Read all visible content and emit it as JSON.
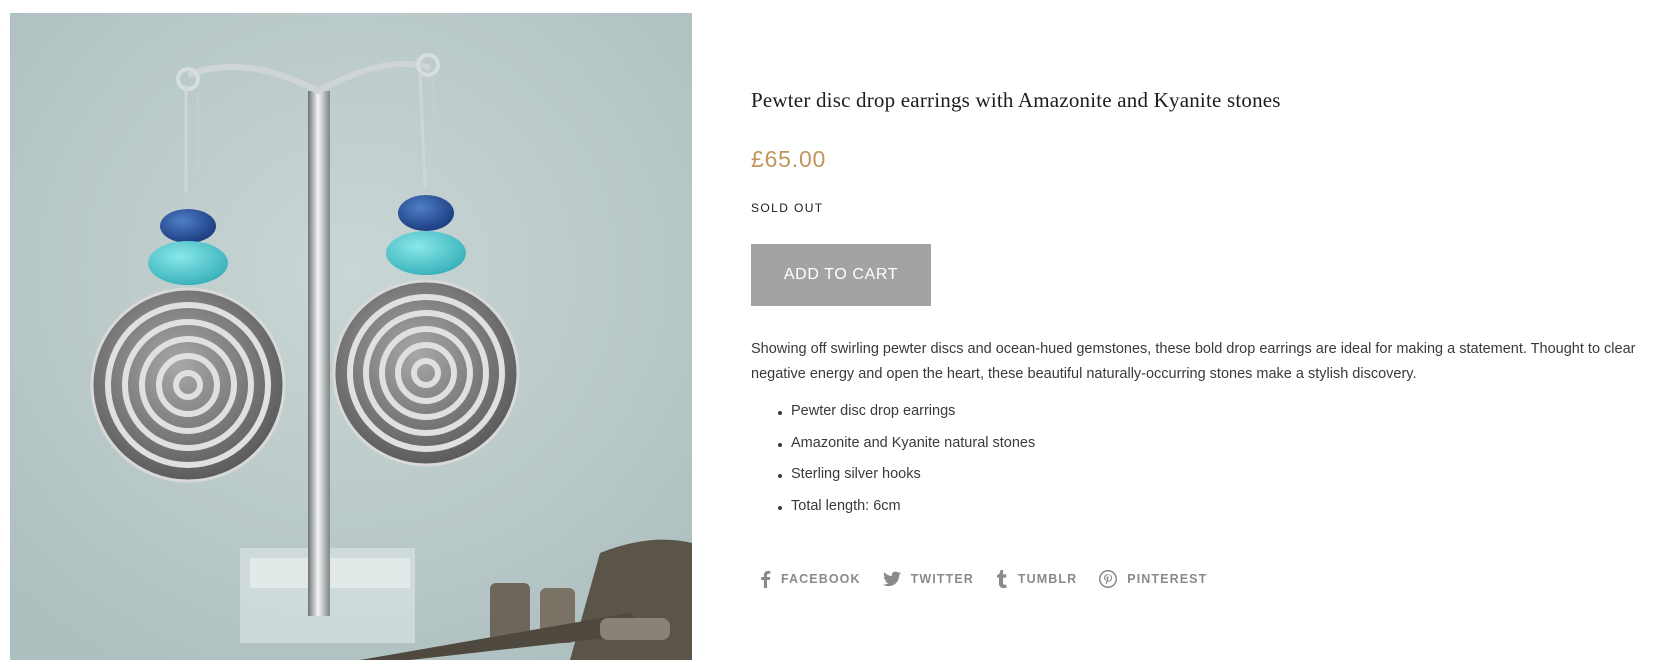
{
  "product": {
    "image_alt": "Pewter disc drop earrings with Amazonite and Kyanite stones on a display stand",
    "title": "Pewter disc drop earrings with Amazonite and Kyanite stones",
    "price": "£65.00",
    "availability": "SOLD OUT",
    "add_to_cart_label": "ADD TO CART",
    "description": "Showing off swirling pewter discs and ocean-hued gemstones, these bold drop earrings are ideal for making a statement. Thought to clear negative energy and open the heart, these beautiful naturally-occurring stones make a stylish discovery.",
    "features": [
      "Pewter disc drop earrings",
      "Amazonite and Kyanite natural stones",
      "Sterling silver hooks",
      "Total length: 6cm"
    ]
  },
  "share": {
    "facebook": {
      "label": "FACEBOOK",
      "icon": "facebook-icon"
    },
    "twitter": {
      "label": "TWITTER",
      "icon": "twitter-icon"
    },
    "tumblr": {
      "label": "TUMBLR",
      "icon": "tumblr-icon"
    },
    "pinterest": {
      "label": "PINTEREST",
      "icon": "pinterest-icon"
    }
  },
  "colors": {
    "price": "#c2955f",
    "button_bg": "#a3a3a3",
    "share_text": "#8a8a8a"
  }
}
